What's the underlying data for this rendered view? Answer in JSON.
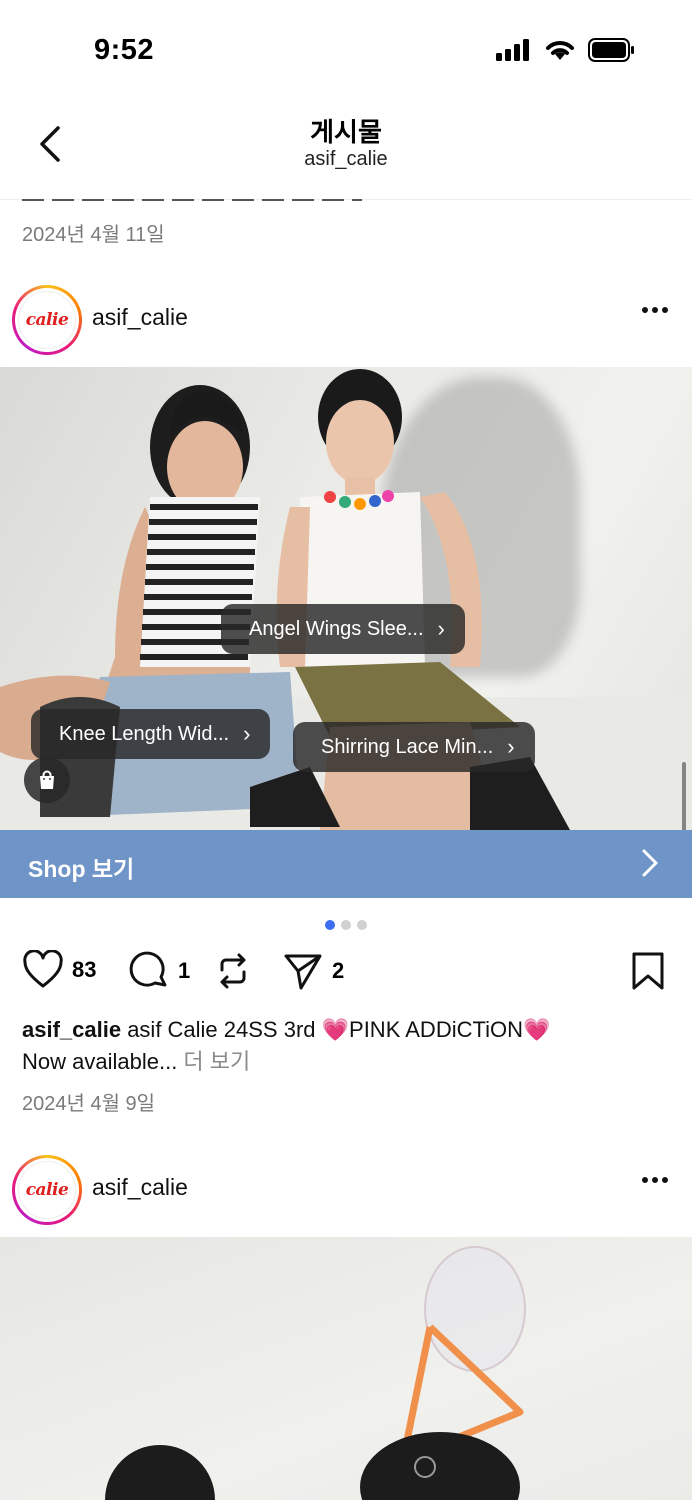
{
  "status": {
    "time": "9:52"
  },
  "nav": {
    "title": "게시물",
    "subtitle": "asif_calie"
  },
  "previous_post": {
    "date": "2024년 4월 11일"
  },
  "post1": {
    "username": "asif_calie",
    "avatar_text": "calie",
    "tags": [
      {
        "label": "Angel Wings Slee..."
      },
      {
        "label": "Knee Length Wid..."
      },
      {
        "label": "Shirring Lace Min..."
      }
    ],
    "shop_label": "Shop 보기",
    "carousel": {
      "count": 3,
      "active": 1
    },
    "likes": "83",
    "comments": "1",
    "shares": "2",
    "caption_user": "asif_calie",
    "caption_text": " asif Calie 24SS 3rd 💗PINK ADDiCTiON💗",
    "caption_line2": "Now available...",
    "more_link": " 더 보기",
    "date": "2024년 4월 9일"
  },
  "post2": {
    "username": "asif_calie",
    "avatar_text": "calie"
  },
  "colors": {
    "shop_bar": "#6f94c7",
    "carousel_active": "#3d6df2"
  },
  "icons": [
    "back-chevron-icon",
    "signal-icon",
    "wifi-icon",
    "battery-icon",
    "more-icon",
    "shopping-bag-icon",
    "heart-icon",
    "comment-icon",
    "repost-icon",
    "send-icon",
    "bookmark-icon",
    "chevron-right-icon"
  ]
}
